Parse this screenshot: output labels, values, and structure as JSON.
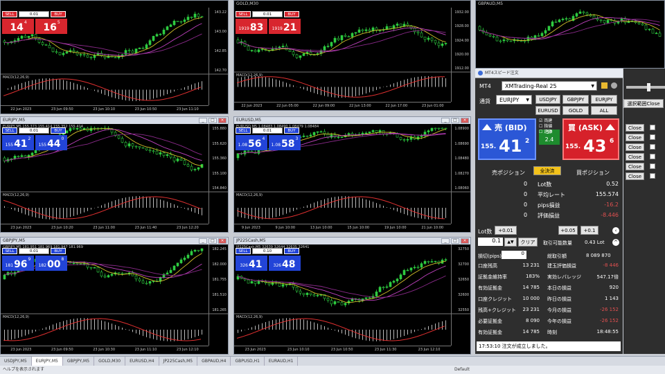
{
  "charts": [
    {
      "id": "c1",
      "title": "",
      "ohlc": "",
      "sell_label": "SELL",
      "buy_label": "BUY",
      "lot": "0.01",
      "sell_big": "14",
      "sell_sup": "4",
      "buy_big": "16",
      "buy_sup": "5",
      "theme": "red",
      "ticks": [
        "143.22",
        "143.00",
        "142.85",
        "142.70"
      ],
      "times": [
        "22 Jun 2023",
        "23 Jun 09:50",
        "23 Jun 10:10",
        "23 Jun 10:50",
        "23 Jun 11:10"
      ]
    },
    {
      "id": "c2",
      "title": "GOLD,M30",
      "ohlc": "",
      "sell_label": "SELL",
      "buy_label": "BUY",
      "lot": "0.01",
      "sell_big": "83",
      "sell_sup": "",
      "buy_big": "21",
      "buy_sup": "",
      "sell_small": "1919",
      "buy_small": "1919",
      "theme": "red",
      "ticks": [
        "1932.00",
        "1928.00",
        "1924.00",
        "1920.00",
        "1912.00"
      ],
      "times": [
        "22 Jun 2023",
        "22 Jun 05:00",
        "22 Jun 09:00",
        "22 Jun 13:00",
        "22 Jun 17:00",
        "23 Jun 01:00"
      ]
    },
    {
      "id": "c3",
      "title": "GBPAUD,M5",
      "ohlc": "",
      "theme": "none",
      "ticks": [],
      "times": []
    },
    {
      "id": "c4",
      "title": "EURJPY,M5",
      "ohlc": "EURJPY,M5 155.373 155.414 155.352 155.414",
      "sell_label": "SELL",
      "buy_label": "BUY",
      "lot": "0.01",
      "sell_big": "41",
      "sell_sup": "2",
      "buy_big": "44",
      "buy_sup": "0",
      "sell_small": "155",
      "buy_small": "155",
      "theme": "blue",
      "ticks": [
        "155.880",
        "155.620",
        "155.360",
        "155.100",
        "154.840"
      ],
      "times": [
        "23 Jun 2023",
        "23 Jun 10:20",
        "23 Jun 11:00",
        "23 Jun 11:40",
        "23 Jun 12:20"
      ]
    },
    {
      "id": "c5",
      "title": "EURUSD,M5",
      "ohlc": "EURUSD,M5 1.08483 1.08490 1.08479 1.08484",
      "sell_label": "SELL",
      "buy_label": "BUY",
      "lot": "0.01",
      "sell_big": "56",
      "sell_sup": "4",
      "buy_big": "58",
      "buy_sup": "3",
      "sell_small": "1.08",
      "buy_small": "1.08",
      "theme": "blue",
      "ticks": [
        "1.08900",
        "1.08690",
        "1.08480",
        "1.08270",
        "1.08060"
      ],
      "times": [
        "9 Jun 2023",
        "9 Jun 10:00",
        "13 Jun 10:00",
        "15 Jun 10:00",
        "19 Jun 10:00",
        "21 Jun 10:00"
      ]
    },
    {
      "id": "c6",
      "title": "GBPJPY,M5",
      "ohlc": "GBPJPY,M5 181.951 181.969 181.947 181.969",
      "sell_label": "SELL",
      "buy_label": "BUY",
      "lot": "0.01",
      "sell_big": "96",
      "sell_sup": "9",
      "buy_big": "00",
      "buy_sup": "8",
      "sell_small": "181",
      "buy_small": "182",
      "theme": "blue",
      "ticks": [
        "182.245",
        "182.000",
        "181.755",
        "181.510",
        "181.265"
      ],
      "times": [
        "23 Jun 2023",
        "23 Jun 09:50",
        "23 Jun 10:30",
        "23 Jun 11:10",
        "23 Jun 12:10"
      ]
    },
    {
      "id": "c7",
      "title": "JP225Cash,M5",
      "ohlc": "JP225Cash,M5 32639 32644 32635 32641",
      "sell_label": "SELL",
      "buy_label": "BUY",
      "lot": "0.10",
      "sell_big": "41",
      "sell_sup": "",
      "buy_big": "48",
      "buy_sup": "",
      "sell_small": "326",
      "buy_small": "326",
      "theme": "blue",
      "ticks": [
        "32750",
        "32700",
        "32650",
        "32600",
        "32550"
      ],
      "times": [
        "23 Jun 2023",
        "23 Jun 10:10",
        "23 Jun 10:50",
        "23 Jun 11:30",
        "23 Jun 12:10"
      ]
    }
  ],
  "panel": {
    "title": "MT4スピード注文",
    "mt4_label": "MT4",
    "account": "XMTrading-Real 25",
    "symbol_label": "通貨",
    "symbol": "EURJPY",
    "symbol_buttons": [
      "USDJPY",
      "GBPJPY",
      "EURJPY",
      "EURUSD",
      "GOLD",
      "ALL"
    ],
    "bid_label": "売 (BID)",
    "ask_label": "買 (ASK)",
    "bid_small": "155.",
    "bid_big": "41",
    "bid_sup": "2",
    "ask_small": "155.",
    "ask_big": "43",
    "ask_sup": "6",
    "spread_label": "SP",
    "spread": "2.4",
    "checks": [
      "両建",
      "指値",
      "逆指"
    ],
    "sell_pos_label": "売ポジション",
    "buy_pos_label": "買ポジション",
    "close_all": "全決済",
    "rows": [
      {
        "left": "0",
        "label": "Lot数",
        "right": "0.52"
      },
      {
        "left": "0",
        "label": "平均レート",
        "right": "155.574"
      },
      {
        "left": "0",
        "label": "pips損益",
        "right": "-16.2"
      },
      {
        "left": "0",
        "label": "評価損益",
        "right": "-8.446"
      }
    ],
    "lot_label": "Lot数",
    "lot_buttons": [
      "+0.01",
      "+0.05",
      "+0.1"
    ],
    "lot_value": "0.1",
    "clear_label": "クリア",
    "max_lot_label": "取引可能数量",
    "max_lot_value": "0.43 Lot",
    "stop_label": "損切(pips)",
    "stop_value": "0",
    "acct_rows": [
      {
        "l1": "口座残高",
        "v1": "13 231",
        "l2": "建玉評価損益",
        "v2": "-8 446"
      },
      {
        "l1": "証拠金維持率",
        "v1": "183%",
        "l2": "実効レバレッジ",
        "v2": "547.17倍"
      },
      {
        "l1": "有効証拠金",
        "v1": "14 785",
        "l2": "本日の損益",
        "v2": "920"
      },
      {
        "l1": "口座クレジット",
        "v1": "10 000",
        "l2": "昨日の損益",
        "v2": "1 143"
      },
      {
        "l1": "残高+クレジット",
        "v1": "23 231",
        "l2": "今月の損益",
        "v2": "-26 152"
      },
      {
        "l1": "必要証拠金",
        "v1": "8 090",
        "l2": "今年の損益",
        "v2": "-26 152"
      },
      {
        "l1": "有効証拠金",
        "v1": "14 785",
        "l2": "時刻",
        "v2": "18:48:55"
      }
    ],
    "margin_label": "総取引額",
    "margin_value": "8 089 870",
    "status_msg": "17:53:10 注文が成立しました。"
  },
  "right_strip": {
    "select_close": "選択範囲Close",
    "close_label": "Close",
    "close_count": 6
  },
  "tabs": [
    "USDJPY,M5",
    "EURJPY,M5",
    "GBPJPY,M5",
    "GOLD,M30",
    "EURUSD,H4",
    "JP225Cash,M5",
    "GBPAUD,H4",
    "GBPUSD,H1",
    "EURAUD,H1"
  ],
  "statusbar": {
    "left": "ヘルプを表示されます",
    "right": "Default"
  }
}
